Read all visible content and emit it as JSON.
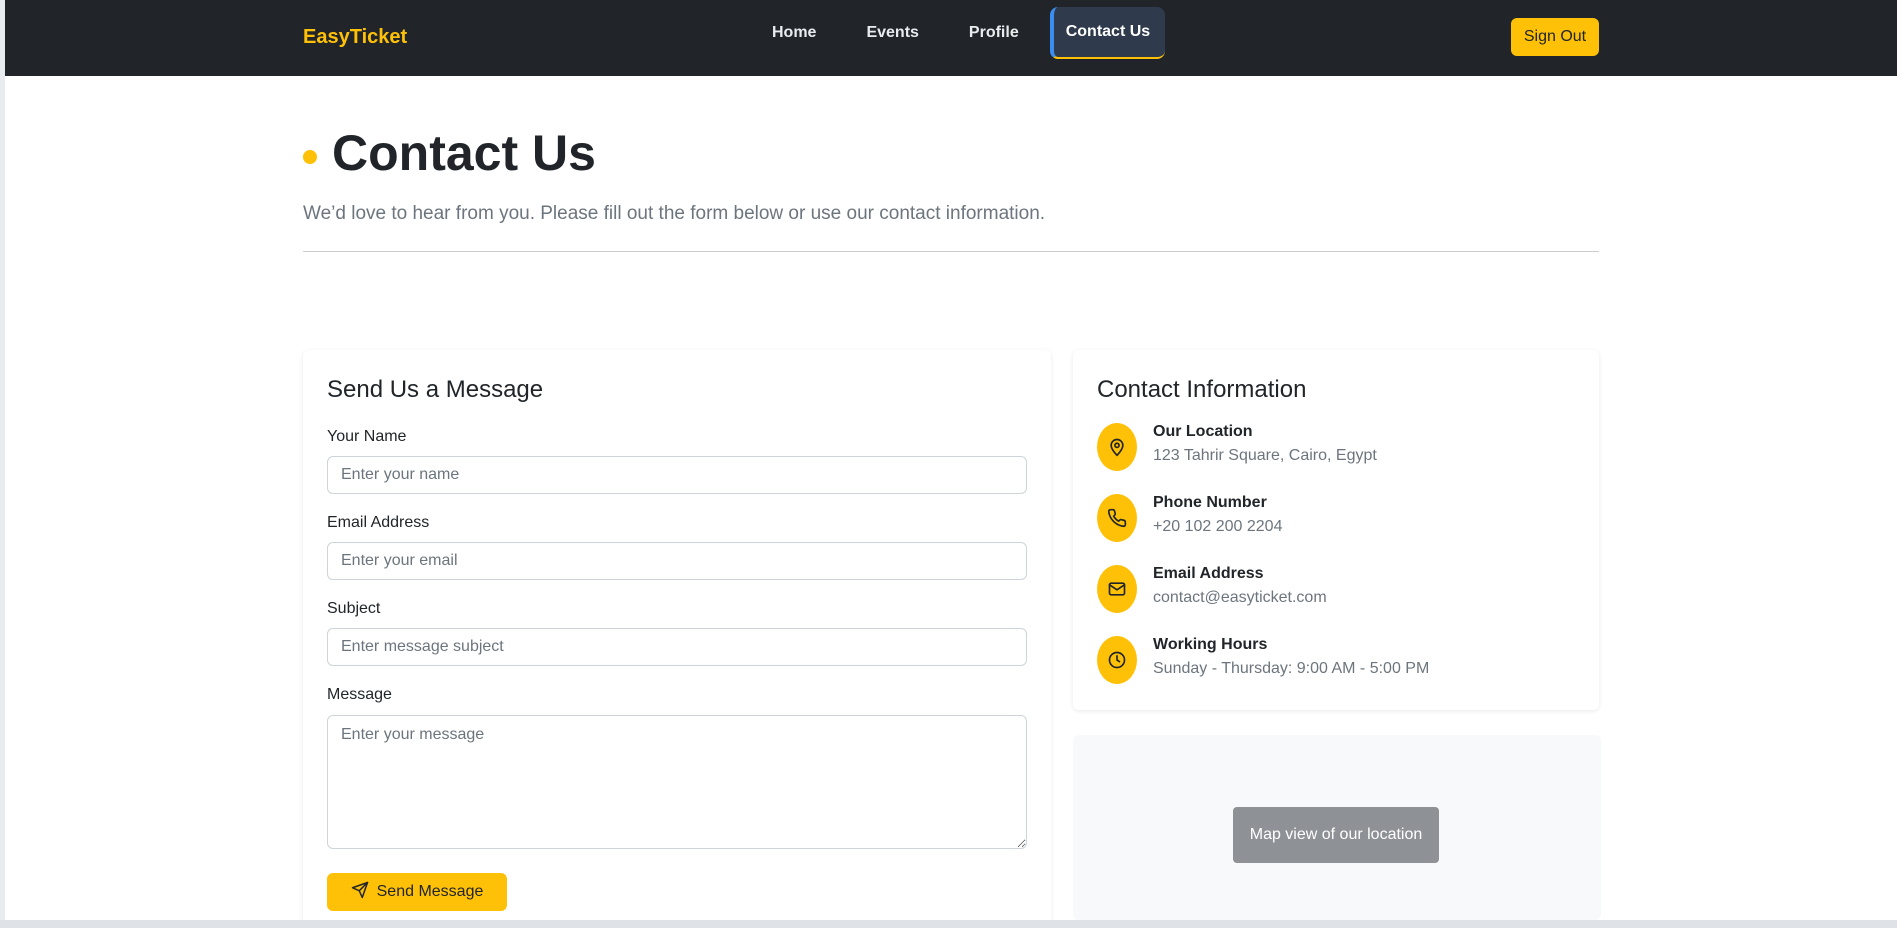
{
  "brand": "EasyTicket",
  "nav": {
    "items": [
      {
        "label": "Home"
      },
      {
        "label": "Events"
      },
      {
        "label": "Profile"
      },
      {
        "label": "Contact Us",
        "active": true
      }
    ],
    "sign_out": "Sign Out"
  },
  "header": {
    "title": "Contact Us",
    "subtitle": "We’d love to hear from you. Please fill out the form below or use our contact information."
  },
  "form": {
    "title": "Send Us a Message",
    "name": {
      "label": "Your Name",
      "placeholder": "Enter your name"
    },
    "email": {
      "label": "Email Address",
      "placeholder": "Enter your email"
    },
    "subject": {
      "label": "Subject",
      "placeholder": "Enter message subject"
    },
    "message": {
      "label": "Message",
      "placeholder": "Enter your message"
    },
    "submit": "Send Message"
  },
  "contact": {
    "title": "Contact Information",
    "items": [
      {
        "icon": "location-pin-icon",
        "label": "Our Location",
        "value": "123 Tahrir Square, Cairo, Egypt"
      },
      {
        "icon": "phone-icon",
        "label": "Phone Number",
        "value": "+20 102 200 2204"
      },
      {
        "icon": "envelope-icon",
        "label": "Email Address",
        "value": "contact@easyticket.com"
      },
      {
        "icon": "clock-icon",
        "label": "Working Hours",
        "value": "Sunday - Thursday: 9:00 AM - 5:00 PM"
      }
    ]
  },
  "map": {
    "label": "Map view of our location"
  },
  "colors": {
    "accent": "#ffc107",
    "navbar": "#212529",
    "active_indicator": "#3b8ef0"
  }
}
